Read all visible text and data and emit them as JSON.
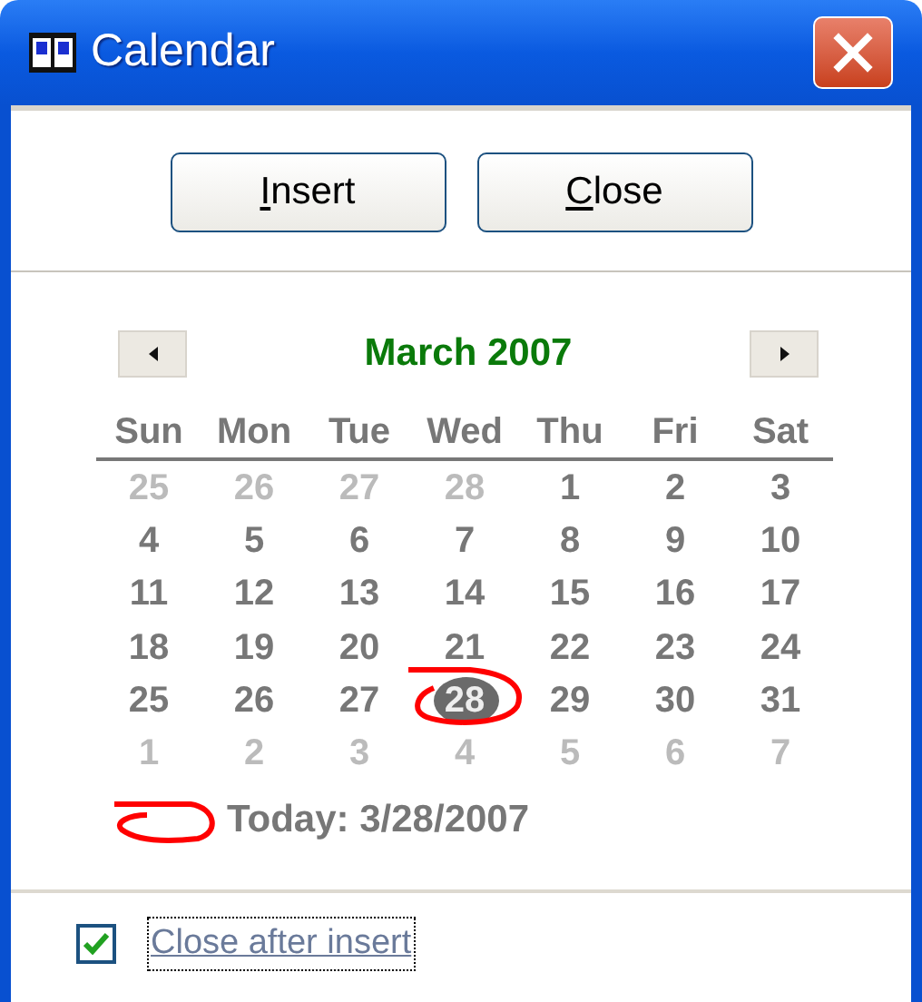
{
  "window": {
    "title": "Calendar"
  },
  "buttons": [
    {
      "label": "Insert",
      "mnemonic_underlined": true
    },
    {
      "label": "Close",
      "mnemonic_underlined": true
    }
  ],
  "calendar": {
    "month_label": "March 2007",
    "weekdays": [
      "Sun",
      "Mon",
      "Tue",
      "Wed",
      "Thu",
      "Fri",
      "Sat"
    ],
    "days": [
      {
        "label": "25",
        "muted": true,
        "selected": false
      },
      {
        "label": "26",
        "muted": true,
        "selected": false
      },
      {
        "label": "27",
        "muted": true,
        "selected": false
      },
      {
        "label": "28",
        "muted": true,
        "selected": false
      },
      {
        "label": "1",
        "muted": false,
        "selected": false
      },
      {
        "label": "2",
        "muted": false,
        "selected": false
      },
      {
        "label": "3",
        "muted": false,
        "selected": false
      },
      {
        "label": "4",
        "muted": false,
        "selected": false
      },
      {
        "label": "5",
        "muted": false,
        "selected": false
      },
      {
        "label": "6",
        "muted": false,
        "selected": false
      },
      {
        "label": "7",
        "muted": false,
        "selected": false
      },
      {
        "label": "8",
        "muted": false,
        "selected": false
      },
      {
        "label": "9",
        "muted": false,
        "selected": false
      },
      {
        "label": "10",
        "muted": false,
        "selected": false
      },
      {
        "label": "11",
        "muted": false,
        "selected": false
      },
      {
        "label": "12",
        "muted": false,
        "selected": false
      },
      {
        "label": "13",
        "muted": false,
        "selected": false
      },
      {
        "label": "14",
        "muted": false,
        "selected": false
      },
      {
        "label": "15",
        "muted": false,
        "selected": false
      },
      {
        "label": "16",
        "muted": false,
        "selected": false
      },
      {
        "label": "17",
        "muted": false,
        "selected": false
      },
      {
        "label": "18",
        "muted": false,
        "selected": false
      },
      {
        "label": "19",
        "muted": false,
        "selected": false
      },
      {
        "label": "20",
        "muted": false,
        "selected": false
      },
      {
        "label": "21",
        "muted": false,
        "selected": false
      },
      {
        "label": "22",
        "muted": false,
        "selected": false
      },
      {
        "label": "23",
        "muted": false,
        "selected": false
      },
      {
        "label": "24",
        "muted": false,
        "selected": false
      },
      {
        "label": "25",
        "muted": false,
        "selected": false
      },
      {
        "label": "26",
        "muted": false,
        "selected": false
      },
      {
        "label": "27",
        "muted": false,
        "selected": false
      },
      {
        "label": "28",
        "muted": false,
        "selected": true
      },
      {
        "label": "29",
        "muted": false,
        "selected": false
      },
      {
        "label": "30",
        "muted": false,
        "selected": false
      },
      {
        "label": "31",
        "muted": false,
        "selected": false
      },
      {
        "label": "1",
        "muted": true,
        "selected": false
      },
      {
        "label": "2",
        "muted": true,
        "selected": false
      },
      {
        "label": "3",
        "muted": true,
        "selected": false
      },
      {
        "label": "4",
        "muted": true,
        "selected": false
      },
      {
        "label": "5",
        "muted": true,
        "selected": false
      },
      {
        "label": "6",
        "muted": true,
        "selected": false
      },
      {
        "label": "7",
        "muted": true,
        "selected": false
      }
    ],
    "today": "Today: 3/28/2007"
  },
  "option": {
    "label": "Close after insert",
    "checked": true,
    "focused": true
  }
}
